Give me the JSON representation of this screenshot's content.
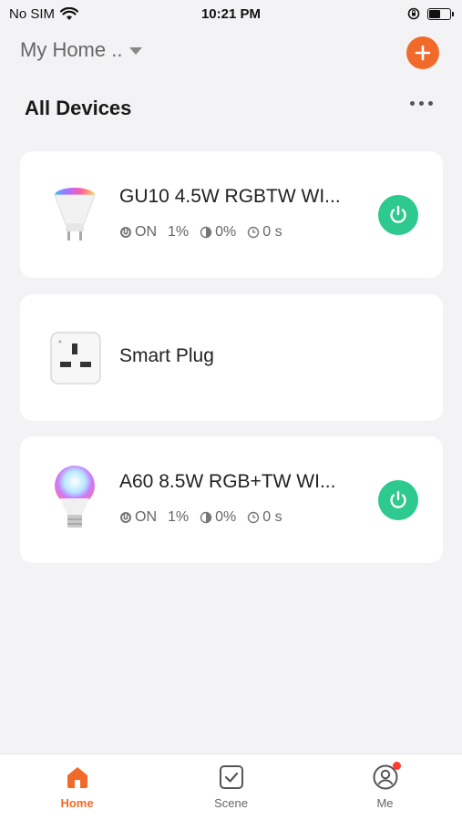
{
  "status_bar": {
    "carrier": "No SIM",
    "time": "10:21 PM"
  },
  "header": {
    "home_name": "My Home ..",
    "add_icon": "plus-icon",
    "accent_color": "#f26a2a"
  },
  "section": {
    "title": "All Devices",
    "more_icon": "ellipsis-icon"
  },
  "devices": [
    {
      "name": "GU10 4.5W RGBTW  WI...",
      "icon": "gu10-bulb-icon",
      "status": {
        "state": "ON",
        "brightness": "1%",
        "temperature": "0%",
        "timer": "0 s"
      },
      "power": "on"
    },
    {
      "name": "Smart Plug",
      "icon": "smart-plug-icon"
    },
    {
      "name": "A60 8.5W RGB+TW WI...",
      "icon": "a60-bulb-icon",
      "status": {
        "state": "ON",
        "brightness": "1%",
        "temperature": "0%",
        "timer": "0 s"
      },
      "power": "on"
    }
  ],
  "tab_bar": {
    "tabs": [
      {
        "label": "Home",
        "icon": "home-icon",
        "active": true
      },
      {
        "label": "Scene",
        "icon": "scene-icon",
        "active": false
      },
      {
        "label": "Me",
        "icon": "profile-icon",
        "active": false,
        "has_notification": true
      }
    ]
  },
  "colors": {
    "power_on": "#2dc98e",
    "accent": "#f26a2a",
    "background": "#f3f3f5"
  }
}
